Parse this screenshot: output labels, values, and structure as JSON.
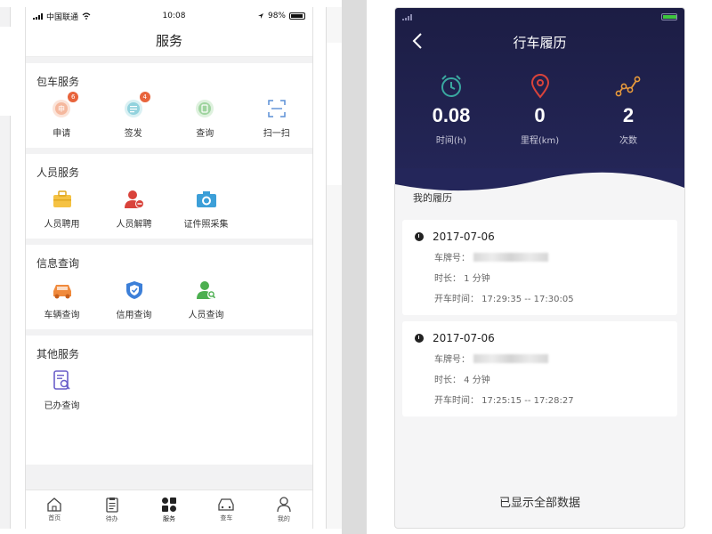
{
  "left": {
    "status": {
      "carrier": "中国联通",
      "time": "10:08",
      "battery": "98%"
    },
    "title": "服务",
    "sections": [
      {
        "title": "包车服务",
        "items": [
          {
            "label": "申请",
            "icon": "apply-icon",
            "badge": "6"
          },
          {
            "label": "签发",
            "icon": "issue-icon",
            "badge": "4"
          },
          {
            "label": "查询",
            "icon": "query-icon",
            "badge": ""
          },
          {
            "label": "扫一扫",
            "icon": "scan-icon",
            "badge": ""
          }
        ]
      },
      {
        "title": "人员服务",
        "items": [
          {
            "label": "人员聘用",
            "icon": "briefcase-icon"
          },
          {
            "label": "人员解聘",
            "icon": "person-remove-icon"
          },
          {
            "label": "证件照采集",
            "icon": "camera-icon"
          }
        ]
      },
      {
        "title": "信息查询",
        "items": [
          {
            "label": "车辆查询",
            "icon": "car-icon"
          },
          {
            "label": "信用查询",
            "icon": "shield-icon"
          },
          {
            "label": "人员查询",
            "icon": "person-search-icon"
          }
        ]
      },
      {
        "title": "其他服务",
        "items": [
          {
            "label": "已办查询",
            "icon": "document-search-icon"
          }
        ]
      }
    ],
    "tabs": [
      {
        "label": "首页",
        "icon": "home-icon"
      },
      {
        "label": "待办",
        "icon": "clipboard-icon"
      },
      {
        "label": "服务",
        "icon": "apps-icon"
      },
      {
        "label": "查车",
        "icon": "car-front-icon"
      },
      {
        "label": "我的",
        "icon": "user-icon"
      }
    ]
  },
  "right": {
    "title": "行车履历",
    "stats": [
      {
        "value": "0.08",
        "label": "时间(h)",
        "icon": "alarm-clock-icon"
      },
      {
        "value": "0",
        "label": "里程(km)",
        "icon": "location-pin-icon"
      },
      {
        "value": "2",
        "label": "次数",
        "icon": "route-icon"
      }
    ],
    "list_title": "我的履历",
    "records": [
      {
        "date": "2017-07-06",
        "plate_label": "车牌号：",
        "duration": "时长： 1 分钟",
        "drive_time": "开车时间： 17:29:35 -- 17:30:05"
      },
      {
        "date": "2017-07-06",
        "plate_label": "车牌号：",
        "duration": "时长： 4 分钟",
        "drive_time": "开车时间： 17:25:15 -- 17:28:27"
      }
    ],
    "footer": "已显示全部数据"
  },
  "colors": {
    "hero": "#1c1d44",
    "accent_orange": "#e8643c",
    "teal": "#3aa8a0",
    "green": "#4caf50",
    "blue": "#3c8fd8",
    "red": "#d9433b"
  }
}
